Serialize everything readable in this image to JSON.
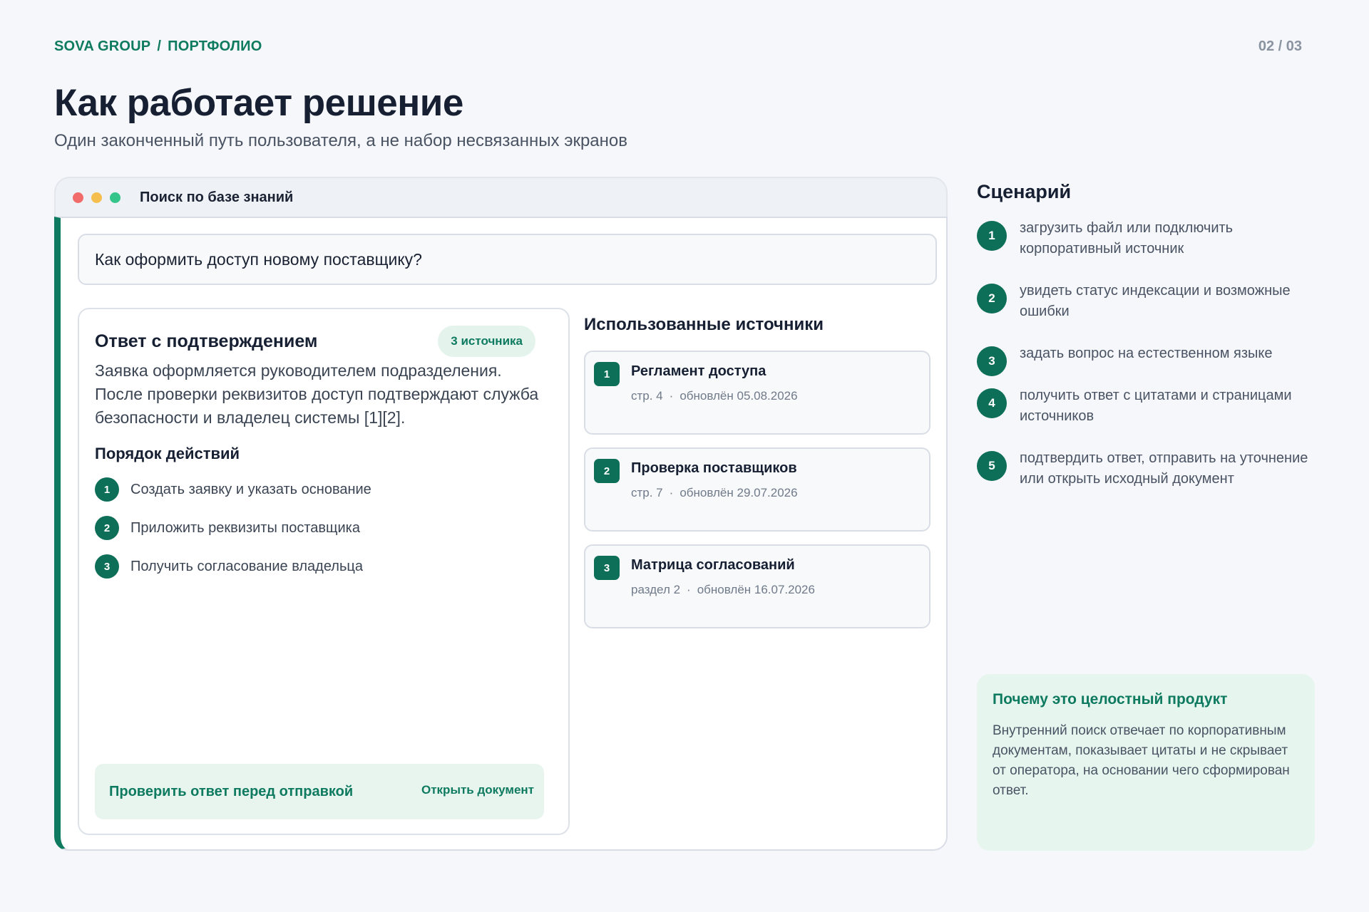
{
  "header": {
    "brand": "SOVA GROUP",
    "separator": "/",
    "section": "ПОРТФОЛИО",
    "pager": "02 / 03"
  },
  "title": "Как работает решение",
  "subtitle": "Один законченный путь пользователя, а не набор несвязанных экранов",
  "window": {
    "title": "Поиск по базе знаний",
    "query": "Как оформить доступ новому поставщику?",
    "answer": {
      "title": "Ответ с подтверждением",
      "badge": "3 источника",
      "text": "Заявка оформляется руководителем подразделения. После проверки реквизитов доступ подтверждают служба безопасности и владелец системы [1][2].",
      "steps_title": "Порядок действий",
      "steps": [
        {
          "num": "1",
          "label": "Создать заявку и указать основание"
        },
        {
          "num": "2",
          "label": "Приложить реквизиты поставщика"
        },
        {
          "num": "3",
          "label": "Получить согласование владельца"
        }
      ],
      "check_button": "Проверить ответ перед отправкой",
      "open_link": "Открыть документ"
    },
    "sources": {
      "title": "Использованные источники",
      "items": [
        {
          "num": "1",
          "name": "Регламент доступа",
          "loc": "стр. 4",
          "sep": "·",
          "updated": "обновлён 05.08.2026"
        },
        {
          "num": "2",
          "name": "Проверка поставщиков",
          "loc": "стр. 7",
          "sep": "·",
          "updated": "обновлён 29.07.2026"
        },
        {
          "num": "3",
          "name": "Матрица согласований",
          "loc": "раздел 2",
          "sep": "·",
          "updated": "обновлён 16.07.2026"
        }
      ]
    }
  },
  "scenario": {
    "title": "Сценарий",
    "steps": [
      {
        "num": "1",
        "label": "загрузить файл или подключить корпоративный источник"
      },
      {
        "num": "2",
        "label": "увидеть статус индексации и возможные ошибки"
      },
      {
        "num": "3",
        "label": "задать вопрос на естественном языке"
      },
      {
        "num": "4",
        "label": "получить ответ с цитатами и страницами источников"
      },
      {
        "num": "5",
        "label": "подтвердить ответ, отправить на уточнение или открыть исходный документ"
      }
    ]
  },
  "why": {
    "title": "Почему это целостный продукт",
    "text": "Внутренний поиск отвечает по корпоративным документам, показывает цитаты и не скрывает от оператора, на основании чего сформирован ответ."
  },
  "colors": {
    "accent": "#0e7a5f",
    "accent_dark": "#0e6f58",
    "accent_light": "#e6f5ee",
    "background": "#f5f7fa",
    "dot_red": "#f26b6b",
    "dot_yellow": "#f5bf4f",
    "dot_green": "#35c48a"
  }
}
